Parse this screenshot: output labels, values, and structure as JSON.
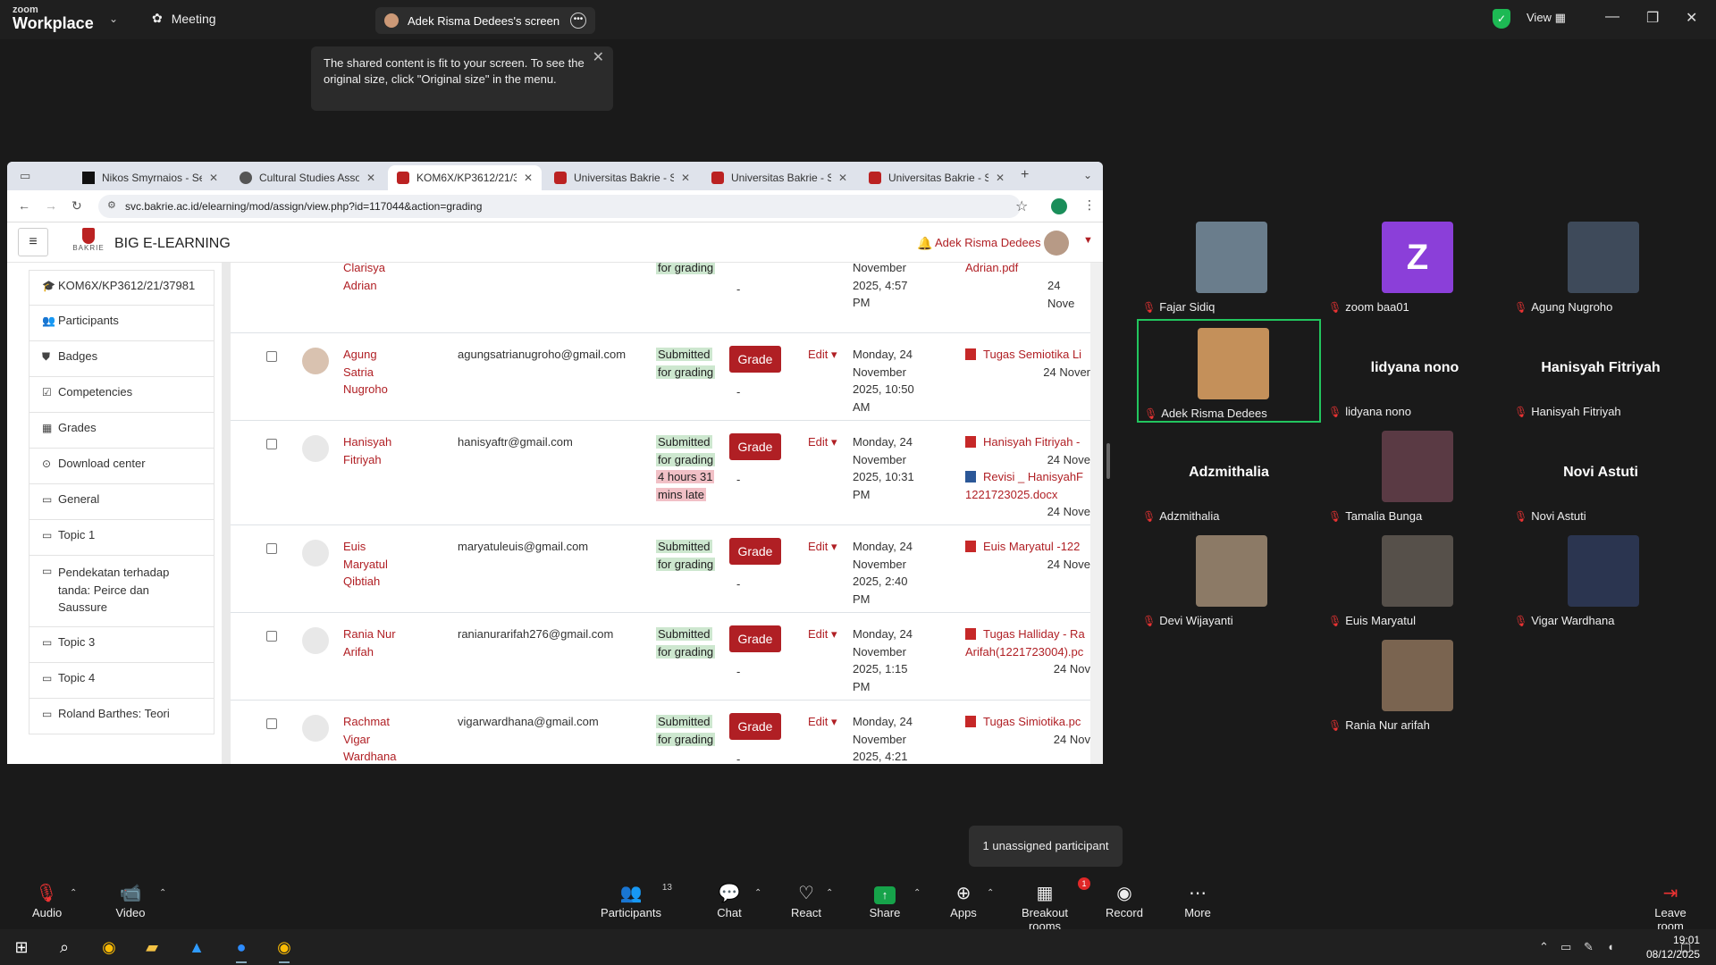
{
  "zoom_top": {
    "logo_line1": "zoom",
    "logo_line2": "Workplace",
    "meeting_label": "Meeting",
    "screen_tab_label": "Adek Risma Dedees's screen",
    "view_label": "View"
  },
  "notice": {
    "text": "The shared content is fit to your screen. To see the original size, click \"Original size\" in the menu."
  },
  "browser": {
    "tabs": [
      {
        "label": "Nikos Smyrnaios - Sear"
      },
      {
        "label": "Cultural Studies Assoc"
      },
      {
        "label": "KOM6X/KP3612/21/379"
      },
      {
        "label": "Universitas Bakrie - SIM"
      },
      {
        "label": "Universitas Bakrie - SIM"
      },
      {
        "label": "Universitas Bakrie - SIM"
      }
    ],
    "url": "svc.bakrie.ac.id/elearning/mod/assign/view.php?id=117044&action=grading",
    "profile_initial": "r"
  },
  "moodle": {
    "brand_sub": "BAKRIE",
    "site_title": "BIG E-LEARNING",
    "user_name": "Adek Risma Dedees",
    "drawer": [
      {
        "label": "KOM6X/KP3612/21/37981",
        "icon": "graduation-cap-icon"
      },
      {
        "label": "Participants",
        "icon": "users-icon"
      },
      {
        "label": "Badges",
        "icon": "shield-icon"
      },
      {
        "label": "Competencies",
        "icon": "check-square-icon"
      },
      {
        "label": "Grades",
        "icon": "table-icon"
      },
      {
        "label": "Download center",
        "icon": "download-icon"
      },
      {
        "label": "General",
        "icon": "folder-icon"
      },
      {
        "label": "Topic 1",
        "icon": "folder-icon"
      },
      {
        "label": "Pendekatan terhadap tanda: Peirce dan Saussure",
        "icon": "folder-icon"
      },
      {
        "label": "Topic 3",
        "icon": "folder-icon"
      },
      {
        "label": "Topic 4",
        "icon": "folder-icon"
      },
      {
        "label": "Roland Barthes: Teori",
        "icon": "folder-icon"
      }
    ],
    "grade_label": "Grade",
    "edit_label": "Edit",
    "dash": "-",
    "partial_row": {
      "name_l1": "Clarisya",
      "name_l2": "Adrian",
      "status_l2": "for grading",
      "date_l1": "November",
      "date_l2": "2025, 4:57",
      "date_l3": "PM",
      "file": "Adrian.pdf",
      "file_date": "24 Nove"
    },
    "rows": [
      {
        "name": [
          "Agung",
          "Satria",
          "Nugroho"
        ],
        "email": "agungsatrianugroho@gmail.com",
        "status": [
          "Submitted",
          "for grading"
        ],
        "late": "",
        "date": [
          "Monday, 24",
          "November",
          "2025, 10:50",
          "AM"
        ],
        "files": [
          {
            "name": "Tugas Semiotika Li",
            "type": "pdf"
          }
        ],
        "file_date": "24 Nover"
      },
      {
        "name": [
          "Hanisyah",
          "Fitriyah"
        ],
        "email": "hanisyaftr@gmail.com",
        "status": [
          "Submitted",
          "for grading"
        ],
        "late": [
          "4 hours 31",
          "mins late"
        ],
        "date": [
          "Monday, 24",
          "November",
          "2025, 10:31",
          "PM"
        ],
        "files": [
          {
            "name": "Hanisyah Fitriyah -",
            "type": "pdf"
          },
          {
            "name": "Revisi _ HanisyahF",
            "type": "doc"
          }
        ],
        "file_extra": "1221723025.docx",
        "file_date": "24 Nove"
      },
      {
        "name": [
          "Euis",
          "Maryatul",
          "Qibtiah"
        ],
        "email": "maryatuleuis@gmail.com",
        "status": [
          "Submitted",
          "for grading"
        ],
        "late": "",
        "date": [
          "Monday, 24",
          "November",
          "2025, 2:40",
          "PM"
        ],
        "files": [
          {
            "name": "Euis Maryatul -122",
            "type": "pdf"
          }
        ],
        "file_date": "24 Nove"
      },
      {
        "name": [
          "Rania Nur",
          "Arifah"
        ],
        "email": "ranianurarifah276@gmail.com",
        "status": [
          "Submitted",
          "for grading"
        ],
        "late": "",
        "date": [
          "Monday, 24",
          "November",
          "2025, 1:15",
          "PM"
        ],
        "files": [
          {
            "name": "Tugas Halliday - Ra",
            "type": "pdf"
          }
        ],
        "file_extra": "Arifah(1221723004).pc",
        "file_date": "24 Nov"
      },
      {
        "name": [
          "Rachmat",
          "Vigar",
          "Wardhana"
        ],
        "email": "vigarwardhana@gmail.com",
        "status": [
          "Submitted",
          "for grading"
        ],
        "late": "",
        "date": [
          "Monday, 24",
          "November",
          "2025, 4:21",
          "PM"
        ],
        "files": [
          {
            "name": "Tugas Simiotika.pc",
            "type": "pdf"
          }
        ],
        "file_date": "24 Nov"
      }
    ]
  },
  "gallery": [
    {
      "label": "Fajar Sidiq",
      "kind": "photo",
      "color": "#6a7d8c"
    },
    {
      "label": "zoom baa01",
      "kind": "letter",
      "letter": "Z"
    },
    {
      "label": "Agung Nugroho",
      "kind": "photo",
      "color": "#3e4a5a"
    },
    {
      "label": "Adek Risma Dedees",
      "kind": "photo",
      "color": "#c4905a",
      "active": true
    },
    {
      "label": "lidyana nono",
      "kind": "name",
      "big": "lidyana nono"
    },
    {
      "label": "Hanisyah Fitriyah",
      "kind": "name",
      "big": "Hanisyah Fitriyah"
    },
    {
      "label": "Adzmithalia",
      "kind": "name",
      "big": "Adzmithalia"
    },
    {
      "label": "Tamalia Bunga",
      "kind": "photo",
      "color": "#5a3a44"
    },
    {
      "label": "Novi Astuti",
      "kind": "name",
      "big": "Novi Astuti"
    },
    {
      "label": "Devi Wijayanti",
      "kind": "photo",
      "color": "#8c7a66"
    },
    {
      "label": "Euis Maryatul",
      "kind": "photo",
      "color": "#56504a"
    },
    {
      "label": "Vigar Wardhana",
      "kind": "photo",
      "color": "#2b3550"
    },
    {
      "label": "Rania Nur arifah",
      "kind": "photo",
      "color": "#7a6450"
    }
  ],
  "unassigned": "1 unassigned participant",
  "toolbar": {
    "audio": "Audio",
    "video": "Video",
    "participants": "Participants",
    "participants_count": "13",
    "chat": "Chat",
    "react": "React",
    "share": "Share",
    "apps": "Apps",
    "breakout": "Breakout rooms",
    "breakout_badge": "1",
    "record": "Record",
    "more": "More",
    "leave": "Leave room"
  },
  "taskbar": {
    "time": "19:01",
    "date": "08/12/2025"
  }
}
